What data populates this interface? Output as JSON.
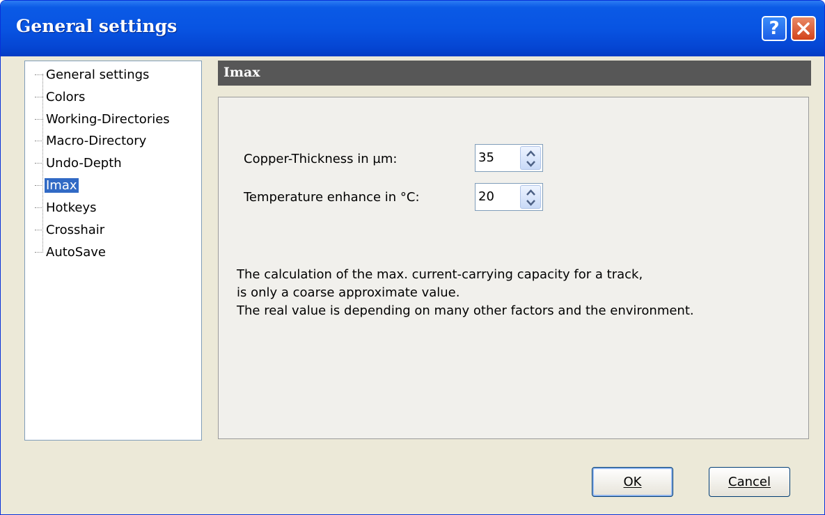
{
  "window": {
    "title": "General settings",
    "help_glyph": "?",
    "close_icon": "close-icon"
  },
  "sidebar": {
    "items": [
      {
        "label": "General settings",
        "selected": false
      },
      {
        "label": "Colors",
        "selected": false
      },
      {
        "label": "Working-Directories",
        "selected": false
      },
      {
        "label": "Macro-Directory",
        "selected": false
      },
      {
        "label": "Undo-Depth",
        "selected": false
      },
      {
        "label": "Imax",
        "selected": true
      },
      {
        "label": "Hotkeys",
        "selected": false
      },
      {
        "label": "Crosshair",
        "selected": false
      },
      {
        "label": "AutoSave",
        "selected": false
      }
    ]
  },
  "section": {
    "title": "Imax"
  },
  "fields": {
    "copper": {
      "label": "Copper-Thickness in µm:",
      "value": "35"
    },
    "temperature": {
      "label": "Temperature enhance in °C:",
      "value": "20"
    }
  },
  "info": {
    "line1": "The calculation of the max. current-carrying capacity for a track,",
    "line2": "is only a coarse approximate value.",
    "line3": "The real value is depending on many other factors and the environment."
  },
  "buttons": {
    "ok": "OK",
    "cancel": "Cancel"
  },
  "colors": {
    "titlebar": "#0854e2",
    "selection": "#316ac5",
    "header_bar": "#575757"
  }
}
